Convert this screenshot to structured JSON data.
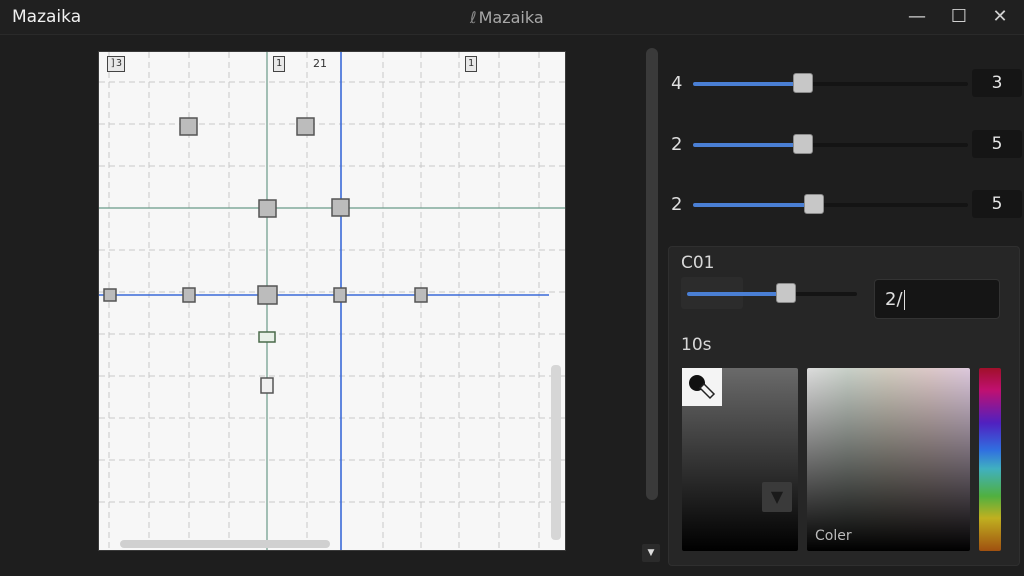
{
  "window": {
    "app_name": "Mazaika",
    "center_title": "Mazaika",
    "controls": {
      "minimize": "—",
      "maximize": "☐",
      "close": "✕"
    }
  },
  "canvas": {
    "tags": [
      "]3",
      "1",
      "1"
    ],
    "number_label": "21"
  },
  "sliders": [
    {
      "label": "4",
      "value": "3",
      "level": 0.4
    },
    {
      "label": "2",
      "value": "5",
      "level": 0.4
    },
    {
      "label": "2",
      "value": "5",
      "level": 0.44
    }
  ],
  "color_section": {
    "title": "C01",
    "slider_level": 0.58,
    "input_value": "2/",
    "subtitle": "10s",
    "spectrum_label": "Coler",
    "down_arrow": "▼",
    "scroll_down_arrow": "▼"
  },
  "colors": {
    "accent": "#4a7fd4",
    "canvas_bg": "#f7f7f7",
    "grid_line": "#c8c8c8",
    "guide_blue": "#3a6ad8",
    "guide_green": "#6a9a88"
  }
}
